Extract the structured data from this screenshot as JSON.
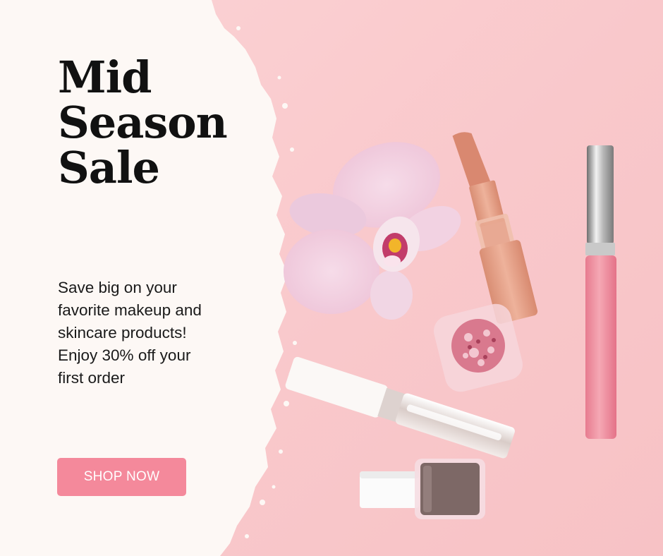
{
  "headline": {
    "lines": [
      "Mid",
      "Season",
      "Sale"
    ]
  },
  "blurb": {
    "lines": [
      "Save big on your",
      "favorite makeup and",
      "skincare products!",
      "Enjoy 30% off your",
      "first order"
    ]
  },
  "cta": {
    "label": "SHOP NOW"
  },
  "colors": {
    "background": "#f9cdd0",
    "panel": "#fdf8f5",
    "button": "#f4899b",
    "title": "#111111"
  },
  "images": [
    "orchid-flower",
    "nude-lipstick",
    "pink-lip-gloss",
    "glitter-jar",
    "white-lip-gloss",
    "nail-polish"
  ]
}
